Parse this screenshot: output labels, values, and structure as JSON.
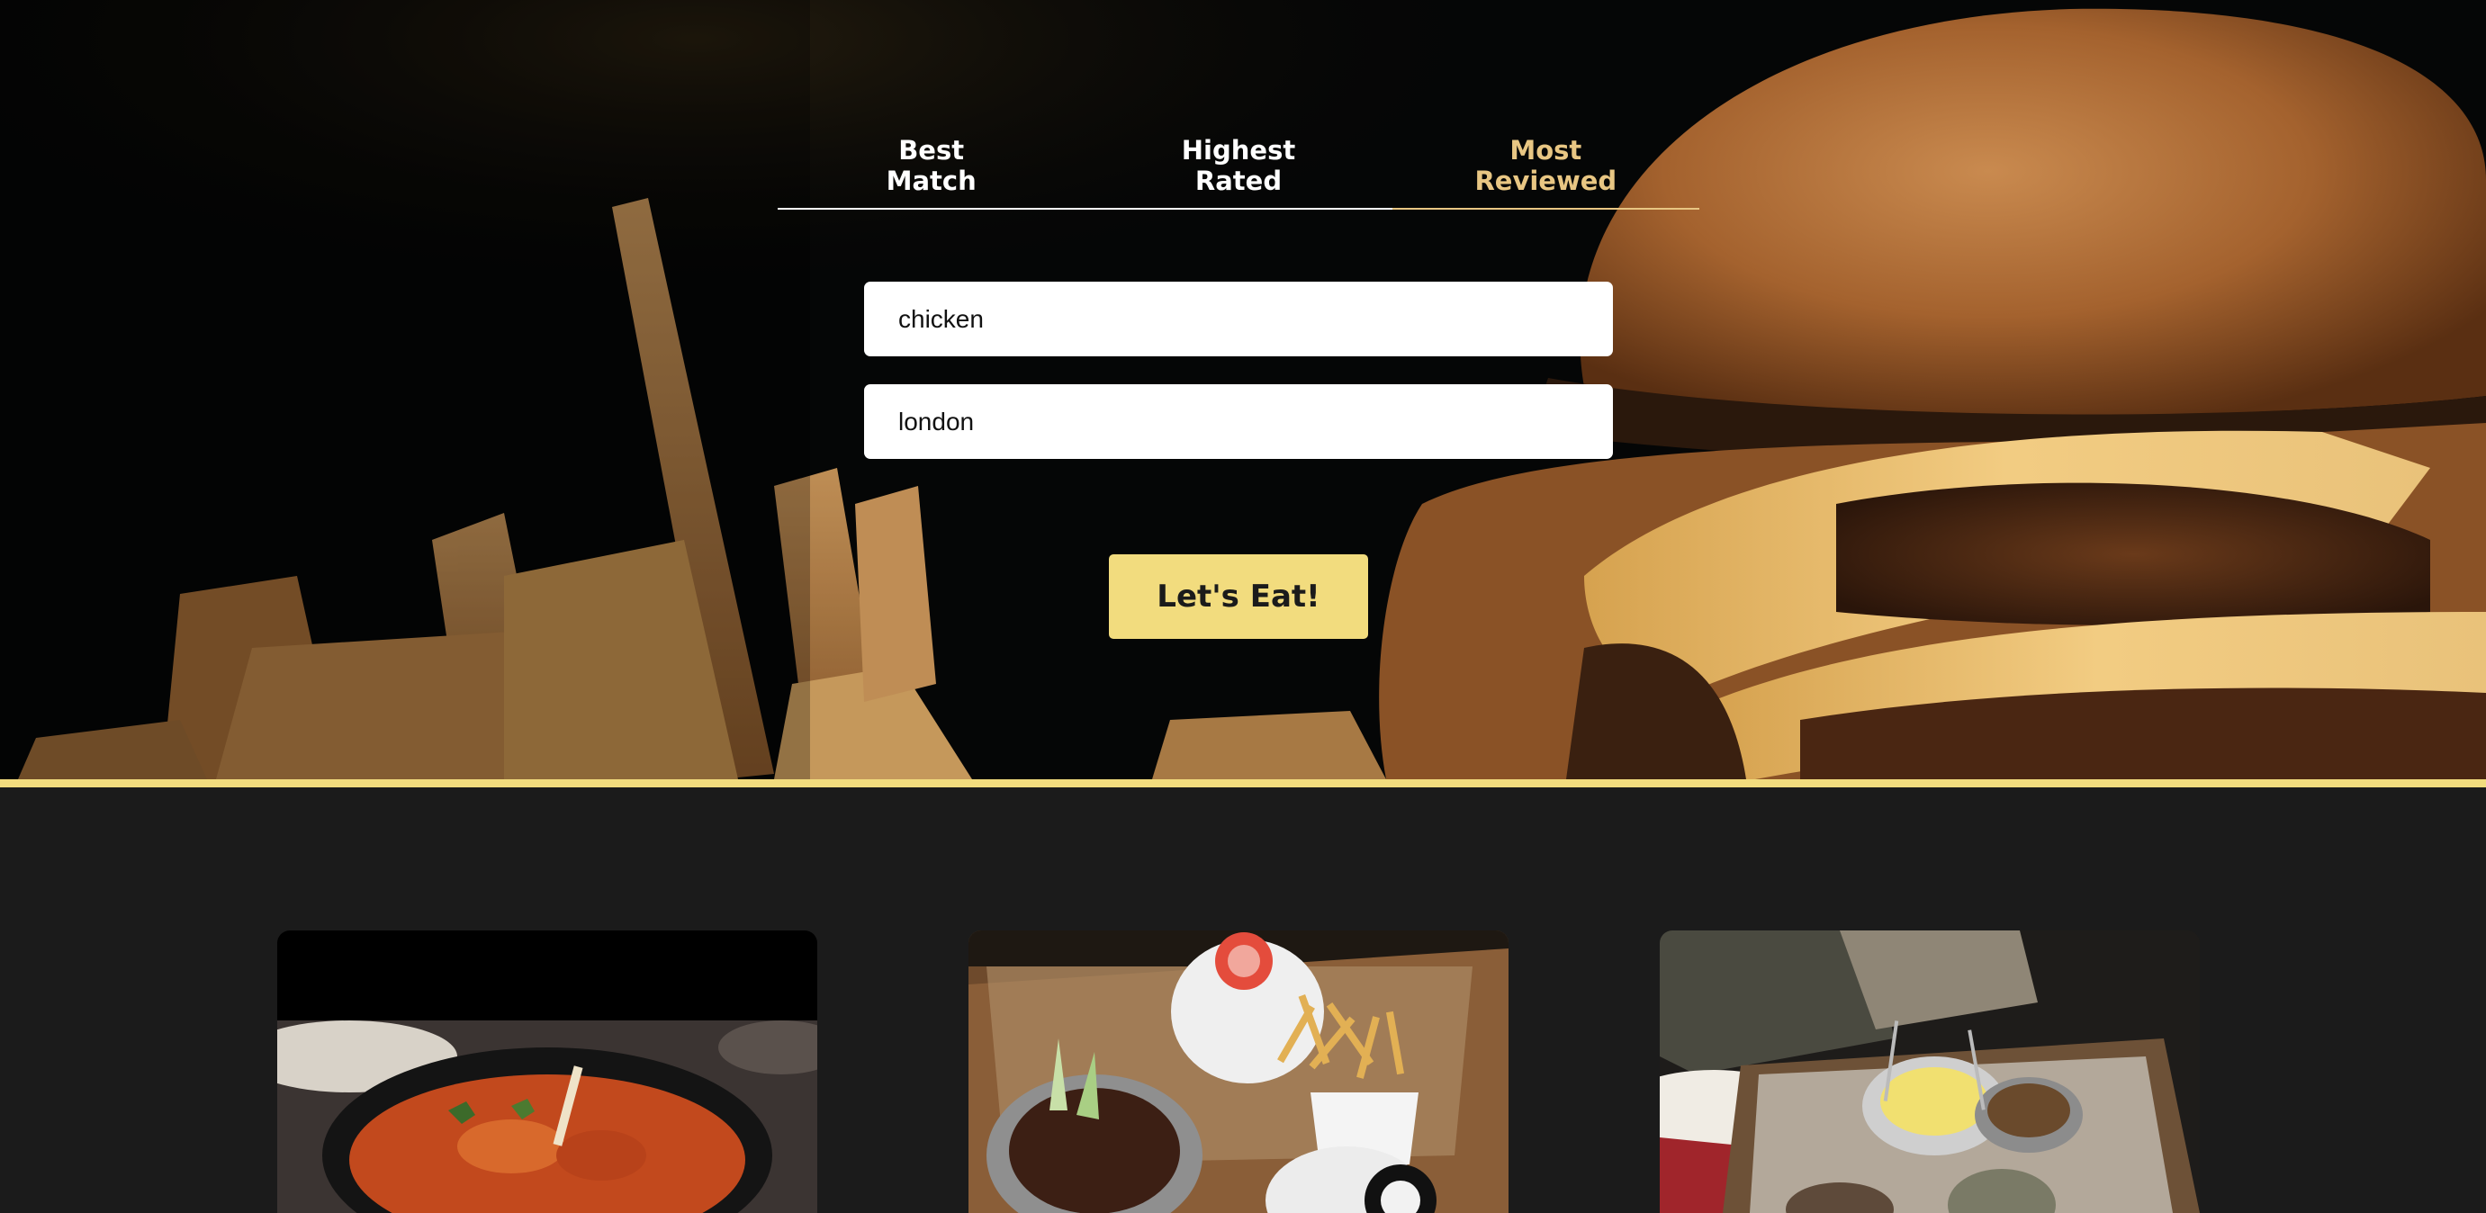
{
  "tabs": [
    {
      "line1": "Best",
      "line2": "Match",
      "active": false
    },
    {
      "line1": "Highest",
      "line2": "Rated",
      "active": false
    },
    {
      "line1": "Most",
      "line2": "Reviewed",
      "active": true
    }
  ],
  "search": {
    "term_value": "chicken",
    "location_value": "london"
  },
  "submit_label": "Let's Eat!",
  "colors": {
    "accent": "#f2dc7e",
    "active_tab": "#e8c683",
    "background": "#1b1b1b"
  },
  "hero_image": "burger-and-fries-photo",
  "results": [
    {
      "image": "curry-bowl-photo"
    },
    {
      "image": "burger-wings-fries-table-photo"
    },
    {
      "image": "dining-table-dishes-photo"
    }
  ]
}
